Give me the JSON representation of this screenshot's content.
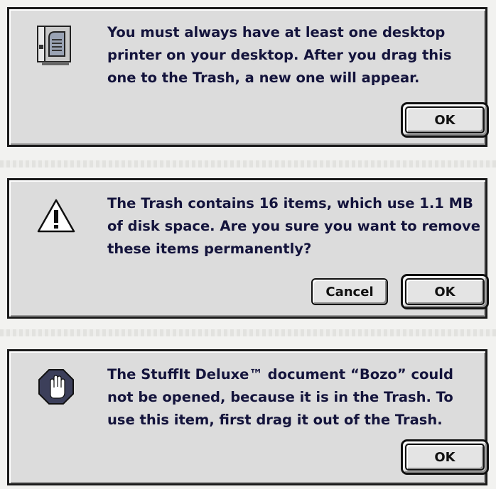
{
  "dialogs": {
    "printer": {
      "icon": "desktop-printer-icon",
      "message": "You must always have at least one desktop printer on your desktop. After you drag this one to the Trash, a new one will appear.",
      "ok_label": "OK"
    },
    "trash": {
      "icon": "caution-triangle-icon",
      "message": "The Trash contains 16 items, which use 1.1 MB of disk space. Are you sure you want to remove these items permanently?",
      "cancel_label": "Cancel",
      "ok_label": "OK"
    },
    "stop": {
      "icon": "stop-hand-icon",
      "message": "The StuffIt Deluxe™ document “Bozo” could not be opened, because it is in the Trash. To use this item, first drag it out of the Trash.",
      "ok_label": "OK"
    }
  },
  "colors": {
    "dialog_bg": "#dcdcdc",
    "text": "#14143c",
    "stop_icon": "#3c3f5a"
  }
}
